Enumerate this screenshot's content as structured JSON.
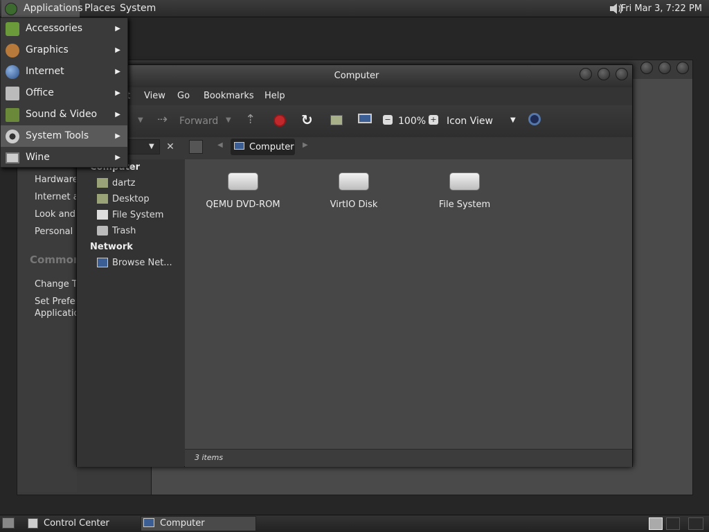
{
  "topbar": {
    "menus": [
      "Applications",
      "Places",
      "System"
    ],
    "clock": "Fri Mar 3, 7:22 PM",
    "volume_icon": "speaker-icon"
  },
  "app_menu": {
    "items": [
      {
        "label": "Accessories",
        "icon": "accessories-icon"
      },
      {
        "label": "Graphics",
        "icon": "graphics-icon"
      },
      {
        "label": "Internet",
        "icon": "globe-icon"
      },
      {
        "label": "Office",
        "icon": "office-icon"
      },
      {
        "label": "Sound & Video",
        "icon": "film-icon"
      },
      {
        "label": "System Tools",
        "icon": "gear-icon"
      },
      {
        "label": "Wine",
        "icon": "wine-icon"
      }
    ],
    "highlighted": "System Tools"
  },
  "control_center": {
    "items": [
      "Hardware",
      "Internet a",
      "Look and I",
      "Personal"
    ],
    "section": "Common",
    "tasks": [
      "Change Th",
      "Set Prefer",
      "Applicatio"
    ]
  },
  "file_manager": {
    "title": "Computer",
    "menu": [
      "t",
      "View",
      "Go",
      "Bookmarks",
      "Help"
    ],
    "toolbar": {
      "forward": "Forward",
      "zoom": "100%",
      "view_mode": "Icon View"
    },
    "location": {
      "current": "Computer"
    },
    "sidebar": {
      "heading_computer": "Computer",
      "places": [
        "dartz",
        "Desktop",
        "File System",
        "Trash"
      ],
      "heading_network": "Network",
      "network": [
        "Browse Net..."
      ]
    },
    "items": [
      "QEMU DVD-ROM",
      "VirtIO Disk",
      "File System"
    ],
    "status": "3 items"
  },
  "taskbar": {
    "tasks": [
      "Control Center",
      "Computer"
    ]
  },
  "colors": {
    "highlight": "#5a5a5a",
    "stop": "#c0282b",
    "drive": "#e0e0e0"
  }
}
